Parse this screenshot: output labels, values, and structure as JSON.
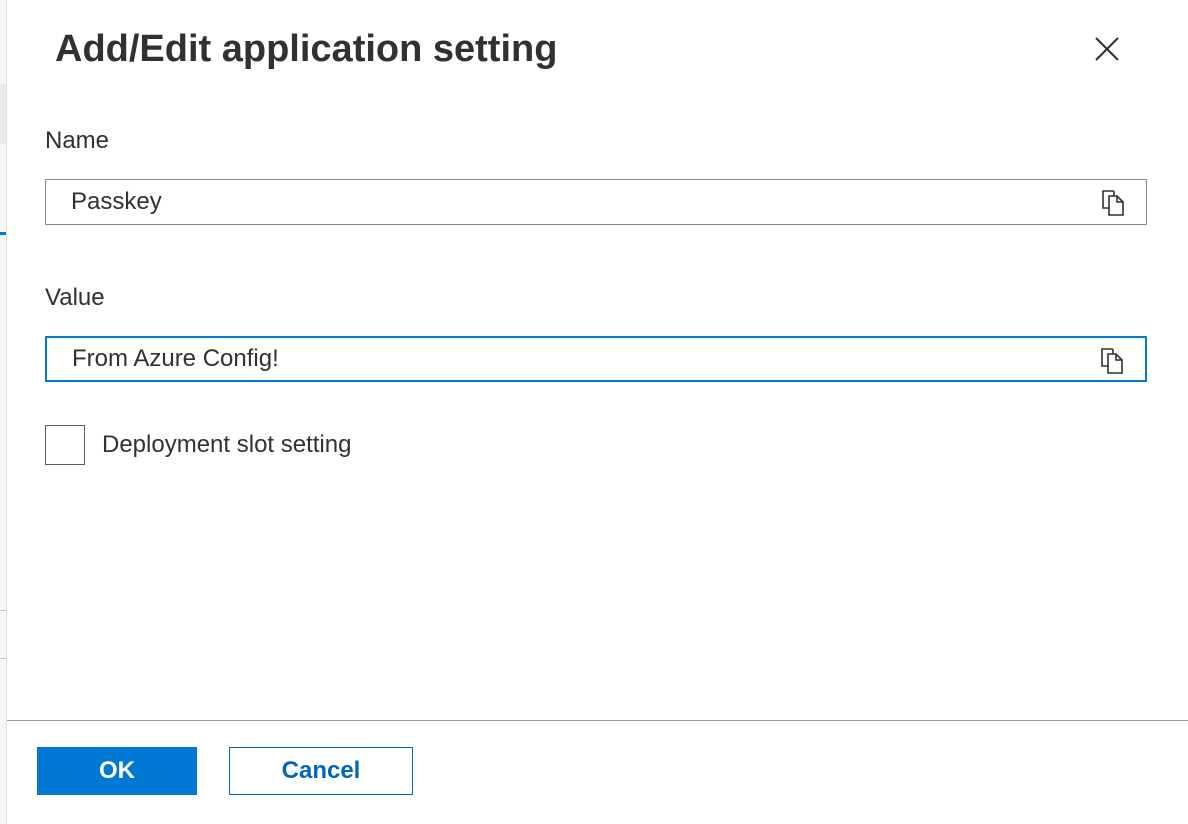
{
  "dialog": {
    "title": "Add/Edit application setting",
    "close_icon": "close-icon"
  },
  "fields": {
    "name": {
      "label": "Name",
      "value": "Passkey",
      "copy_icon": "copy-icon"
    },
    "value": {
      "label": "Value",
      "value": "From Azure Config!",
      "copy_icon": "copy-icon"
    }
  },
  "slot_setting": {
    "label": "Deployment slot setting",
    "checked": false
  },
  "footer": {
    "ok_label": "OK",
    "cancel_label": "Cancel"
  },
  "colors": {
    "accent": "#0078d4",
    "text": "#323130",
    "border": "#8a8886"
  }
}
